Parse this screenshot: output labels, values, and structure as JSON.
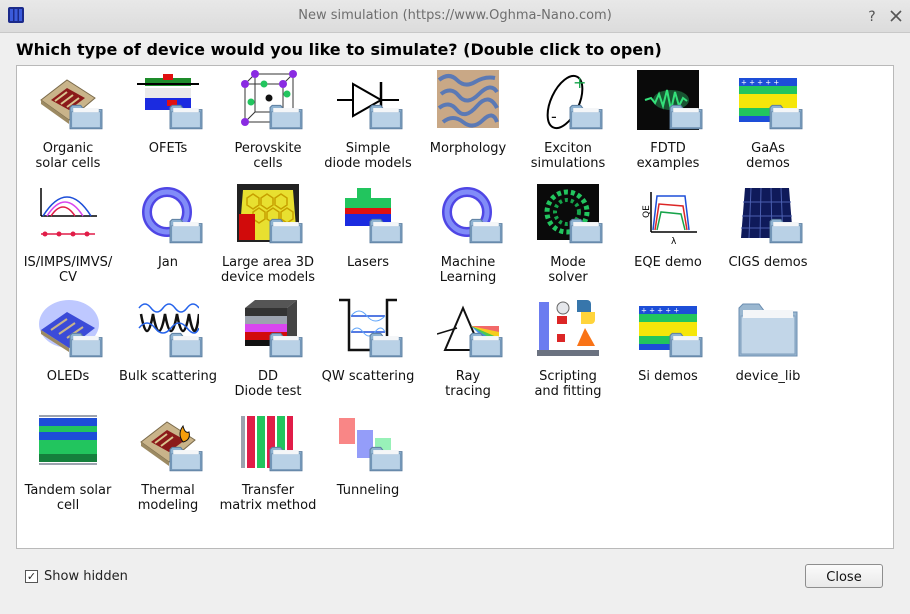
{
  "window": {
    "title": "New simulation (https://www.Oghma-Nano.com)"
  },
  "header": {
    "prompt": "Which type of device would you like to simulate? (Double click to open)"
  },
  "items": [
    {
      "line1": "Organic",
      "line2": "solar cells",
      "icon": "organic-solar-icon"
    },
    {
      "line1": "OFETs",
      "line2": "",
      "icon": "ofet-icon"
    },
    {
      "line1": "Perovskite",
      "line2": "cells",
      "icon": "perovskite-icon"
    },
    {
      "line1": "Simple",
      "line2": "diode models",
      "icon": "diode-icon"
    },
    {
      "line1": "Morphology",
      "line2": "",
      "icon": "morphology-icon"
    },
    {
      "line1": "Exciton",
      "line2": "simulations",
      "icon": "exciton-icon"
    },
    {
      "line1": "FDTD",
      "line2": "examples",
      "icon": "fdtd-icon"
    },
    {
      "line1": "GaAs",
      "line2": "demos",
      "icon": "gaas-icon"
    },
    {
      "line1": "IS/IMPS/IMVS/",
      "line2": "CV",
      "icon": "is-imps-icon"
    },
    {
      "line1": "Jan",
      "line2": "",
      "icon": "ring-icon"
    },
    {
      "line1": "Large area 3D",
      "line2": "device models",
      "icon": "large-area-icon"
    },
    {
      "line1": "Lasers",
      "line2": "",
      "icon": "laser-icon"
    },
    {
      "line1": "Machine",
      "line2": "Learning",
      "icon": "ring-icon"
    },
    {
      "line1": "Mode",
      "line2": "solver",
      "icon": "mode-solver-icon"
    },
    {
      "line1": "EQE demo",
      "line2": "",
      "icon": "eqe-icon"
    },
    {
      "line1": "CIGS demos",
      "line2": "",
      "icon": "cigs-icon"
    },
    {
      "line1": "OLEDs",
      "line2": "",
      "icon": "oled-icon"
    },
    {
      "line1": "Bulk scattering",
      "line2": "",
      "icon": "bulk-scattering-icon"
    },
    {
      "line1": "DD",
      "line2": "Diode test",
      "icon": "dd-diode-icon"
    },
    {
      "line1": "QW scattering",
      "line2": "",
      "icon": "qw-scattering-icon"
    },
    {
      "line1": "Ray",
      "line2": "tracing",
      "icon": "prism-icon"
    },
    {
      "line1": "Scripting",
      "line2": "and fitting",
      "icon": "scripting-icon"
    },
    {
      "line1": "Si demos",
      "line2": "",
      "icon": "si-icon"
    },
    {
      "line1": "device_lib",
      "line2": "",
      "icon": "folder-icon"
    },
    {
      "line1": "Tandem solar",
      "line2": "cell",
      "icon": "tandem-icon"
    },
    {
      "line1": "Thermal",
      "line2": "modeling",
      "icon": "thermal-icon"
    },
    {
      "line1": "Transfer",
      "line2": "matrix method",
      "icon": "transfer-matrix-icon"
    },
    {
      "line1": "Tunneling",
      "line2": "",
      "icon": "tunneling-icon"
    }
  ],
  "footer": {
    "show_hidden_label": "Show hidden",
    "show_hidden_mark": "✓",
    "close_label": "Close"
  }
}
